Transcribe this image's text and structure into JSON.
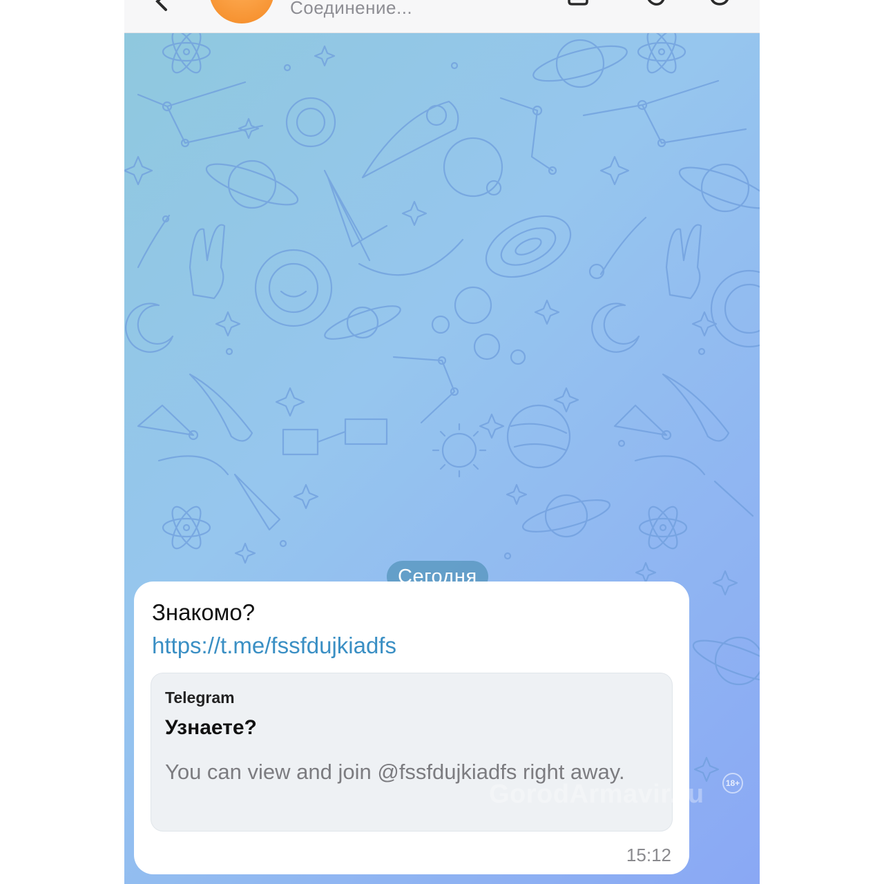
{
  "header": {
    "status": "Соединение..."
  },
  "chat": {
    "date_separator": "Сегодня",
    "message": {
      "text": "Знакомо?",
      "link": "https://t.me/fssfdujkiadfs",
      "preview": {
        "site": "Telegram",
        "title": "Узнаете?",
        "description": "You can view and join @fssfdujkiadfs right away."
      },
      "time": "15:12"
    }
  },
  "watermark": {
    "text": "GorodArmavir.ru",
    "badge": "18+"
  },
  "colors": {
    "background_start": "#8fc8de",
    "background_end": "#8aa8f4",
    "link": "#3a8fc4",
    "pattern_line": "#6f9edd",
    "avatar": "#f48a25"
  },
  "icons": [
    "back-arrow-icon",
    "call-icon",
    "search-icon",
    "menu-icon"
  ]
}
